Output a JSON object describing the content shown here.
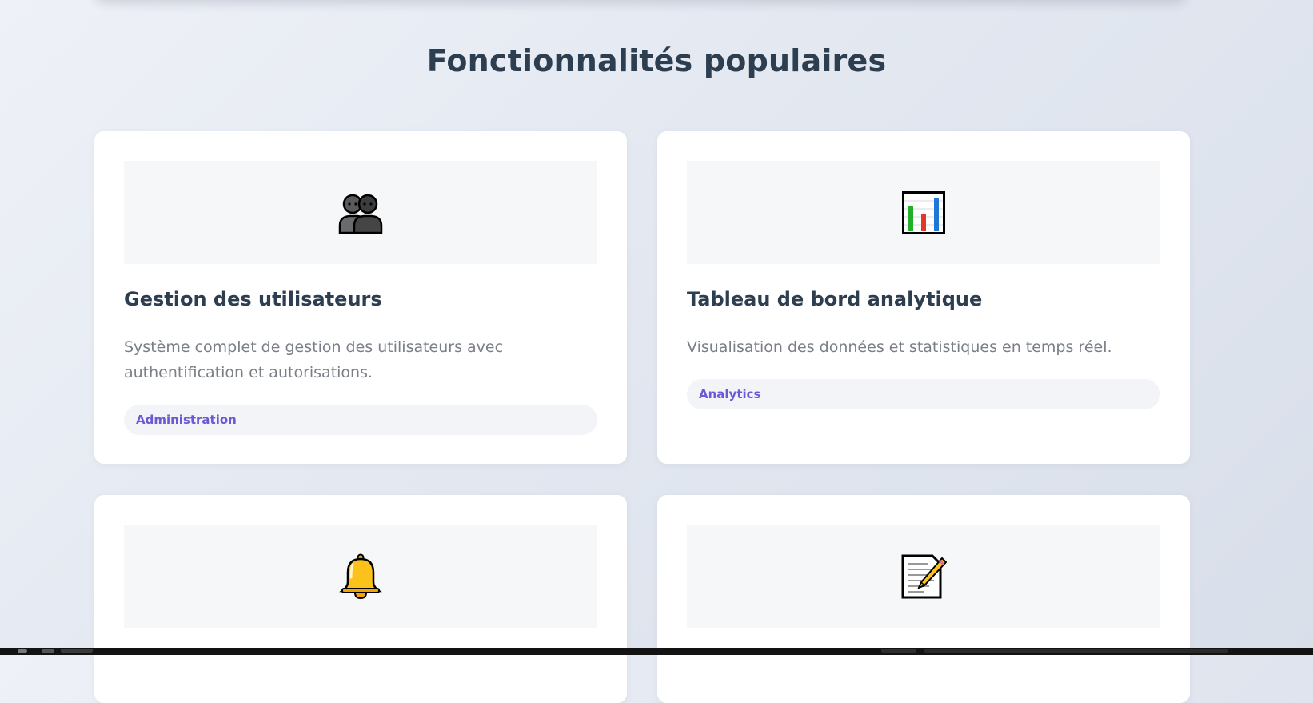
{
  "section": {
    "title": "Fonctionnalités populaires"
  },
  "cards": [
    {
      "icon": "users-icon",
      "title": "Gestion des utilisateurs",
      "description": "Système complet de gestion des utilisateurs avec authentification et autorisations.",
      "tag": "Administration"
    },
    {
      "icon": "bar-chart-icon",
      "title": "Tableau de bord analytique",
      "description": "Visualisation des données et statistiques en temps réel.",
      "tag": "Analytics"
    },
    {
      "icon": "bell-icon"
    },
    {
      "icon": "memo-icon"
    }
  ],
  "colors": {
    "heading": "#2c3e50",
    "description": "#7a7f87",
    "tag_text": "#6a5ad6",
    "tag_background": "#f2f4f8",
    "media_background": "#f6f7f9"
  }
}
